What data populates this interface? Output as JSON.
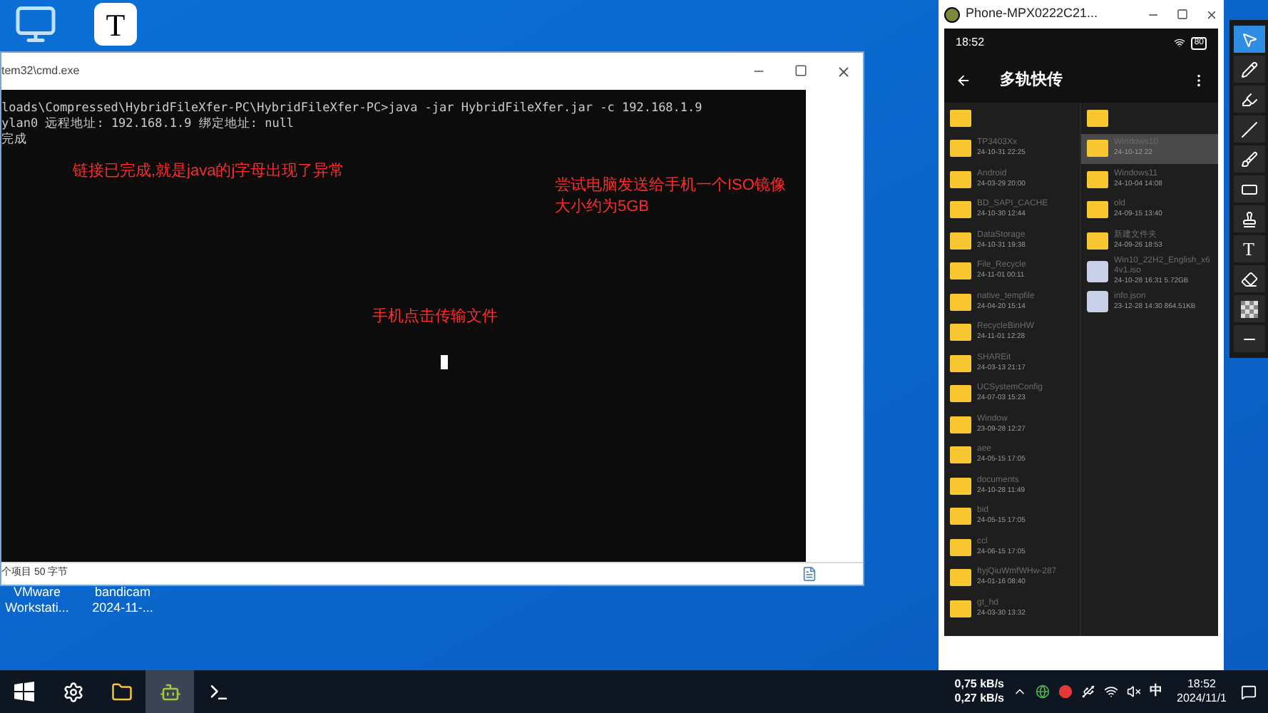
{
  "desktop_icons": [
    {
      "kind": "monitor"
    },
    {
      "kind": "text",
      "label": "T"
    }
  ],
  "desktop_shortcuts": [
    {
      "line1": "VMware",
      "line2": "Workstati..."
    },
    {
      "line1": "bandicam",
      "line2": "2024-11-..."
    }
  ],
  "cmd": {
    "title": "tem32\\cmd.exe",
    "lines": [
      "loads\\Compressed\\HybridFileXfer-PC\\HybridFileXfer-PC>java -jar HybridFileXfer.jar -c 192.168.1.9",
      "ylan0 远程地址: 192.168.1.9 绑定地址: null",
      "完成"
    ],
    "status": "个项目  50 字节"
  },
  "annotations": [
    {
      "lines": [
        "链接已完成,就是java的j字母出现了异常"
      ]
    },
    {
      "lines": [
        "尝试电脑发送给手机一个ISO镜像",
        "大小约为5GB"
      ]
    },
    {
      "lines": [
        "手机点击传输文件"
      ]
    }
  ],
  "phone": {
    "title": "Phone-MPX0222C21...",
    "time": "18:52",
    "battery": "80",
    "app_title": "多轨快传",
    "left_files": [
      {
        "kind": "folder",
        "selected": false
      },
      {
        "kind": "folder",
        "name": "TP3403Xx",
        "date": "24-10-31 22:25",
        "selected": false
      },
      {
        "kind": "folder",
        "name": "Android",
        "date": "24-03-29 20:00",
        "selected": false
      },
      {
        "kind": "folder",
        "name": "BD_SAPI_CACHE",
        "date": "24-10-30 12:44",
        "selected": false
      },
      {
        "kind": "folder",
        "name": "DataStorage",
        "date": "24-10-31 19:38",
        "selected": false
      },
      {
        "kind": "folder",
        "name": "File_Recycle",
        "date": "24-11-01 00:11",
        "selected": false
      },
      {
        "kind": "folder",
        "name": "native_tempfile",
        "date": "24-04-20 15:14",
        "selected": false
      },
      {
        "kind": "folder",
        "name": "RecycleBinHW",
        "date": "24-11-01 12:28",
        "selected": false
      },
      {
        "kind": "folder",
        "name": "SHAREit",
        "date": "24-03-13 21:17",
        "selected": false
      },
      {
        "kind": "folder",
        "name": "UCSystemConfig",
        "date": "24-07-03 15:23",
        "selected": false
      },
      {
        "kind": "folder",
        "name": "Window",
        "date": "23-09-28 12:27",
        "selected": false
      },
      {
        "kind": "folder",
        "name": "aee",
        "date": "24-05-15 17:05",
        "selected": false
      },
      {
        "kind": "folder",
        "name": "documents",
        "date": "24-10-28 11:49",
        "selected": false
      },
      {
        "kind": "folder",
        "name": "bid",
        "date": "24-05-15 17:05",
        "selected": false
      },
      {
        "kind": "folder",
        "name": "ccl",
        "date": "24-06-15 17:05",
        "selected": false
      },
      {
        "kind": "folder",
        "name": "ftyjQiuWmfWHw-287",
        "date": "24-01-16 08:40",
        "selected": false
      },
      {
        "kind": "folder",
        "name": "gt_hd",
        "date": "24-03-30 13:32",
        "selected": false
      }
    ],
    "right_files": [
      {
        "kind": "folder",
        "selected": false
      },
      {
        "kind": "folder",
        "name": "Windows10",
        "date": "24-10-12 22",
        "selected": true
      },
      {
        "kind": "folder",
        "name": "Windows11",
        "date": "24-10-04 14:08",
        "selected": false
      },
      {
        "kind": "folder",
        "name": "old",
        "date": "24-09-15 13:40",
        "selected": false
      },
      {
        "kind": "folder",
        "name": "新建文件夹",
        "date": "24-09-26 18:53",
        "selected": false
      },
      {
        "kind": "file",
        "name": "Win10_22H2_English_x64v1.iso",
        "date": "24-10-28 16:31 5.72GB",
        "selected": false
      },
      {
        "kind": "file",
        "name": "info.json",
        "date": "23-12-28 14:30 864.51KB",
        "selected": false
      }
    ]
  },
  "tools": [
    {
      "kind": "pointer",
      "selected": true
    },
    {
      "kind": "pencil",
      "selected": false
    },
    {
      "kind": "marker",
      "selected": false
    },
    {
      "kind": "line",
      "selected": false
    },
    {
      "kind": "brush",
      "selected": false
    },
    {
      "kind": "rect",
      "selected": false
    },
    {
      "kind": "stamp",
      "selected": false
    },
    {
      "kind": "text",
      "label": "T",
      "selected": false
    },
    {
      "kind": "eraser",
      "selected": false
    },
    {
      "kind": "checker",
      "selected": false
    },
    {
      "kind": "thin",
      "selected": false
    }
  ],
  "taskbar": {
    "apps": [
      {
        "kind": "start",
        "selected": false
      },
      {
        "kind": "gear",
        "selected": false
      },
      {
        "kind": "folder",
        "selected": false
      },
      {
        "kind": "android",
        "selected": true
      },
      {
        "kind": "console",
        "selected": false
      }
    ],
    "net_up": "0,75 kB/s",
    "net_down": "0,27 kB/s",
    "ime": "中",
    "time": "18:52",
    "date": "2024/11/1"
  }
}
